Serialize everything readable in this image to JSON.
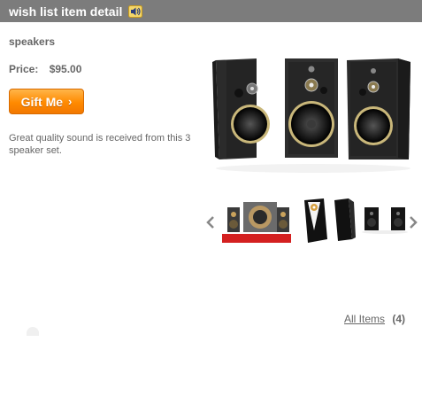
{
  "header": {
    "title": "wish list item detail",
    "audio_icon": "speaker-icon",
    "background_color": "#7c7c7c"
  },
  "item": {
    "name": "speakers",
    "price_label": "Price:",
    "price_value": "$95.00",
    "description": "Great quality sound is received from this 3 speaker set."
  },
  "gift_button": {
    "label": "Gift Me",
    "chevron": "›",
    "color": "#ff8a00"
  },
  "gallery": {
    "prev_icon": "chevron-left-icon",
    "next_icon": "chevron-right-icon",
    "thumbnail_count": 3
  },
  "footer": {
    "all_items_label": "All Items",
    "all_items_count": "(4)"
  }
}
